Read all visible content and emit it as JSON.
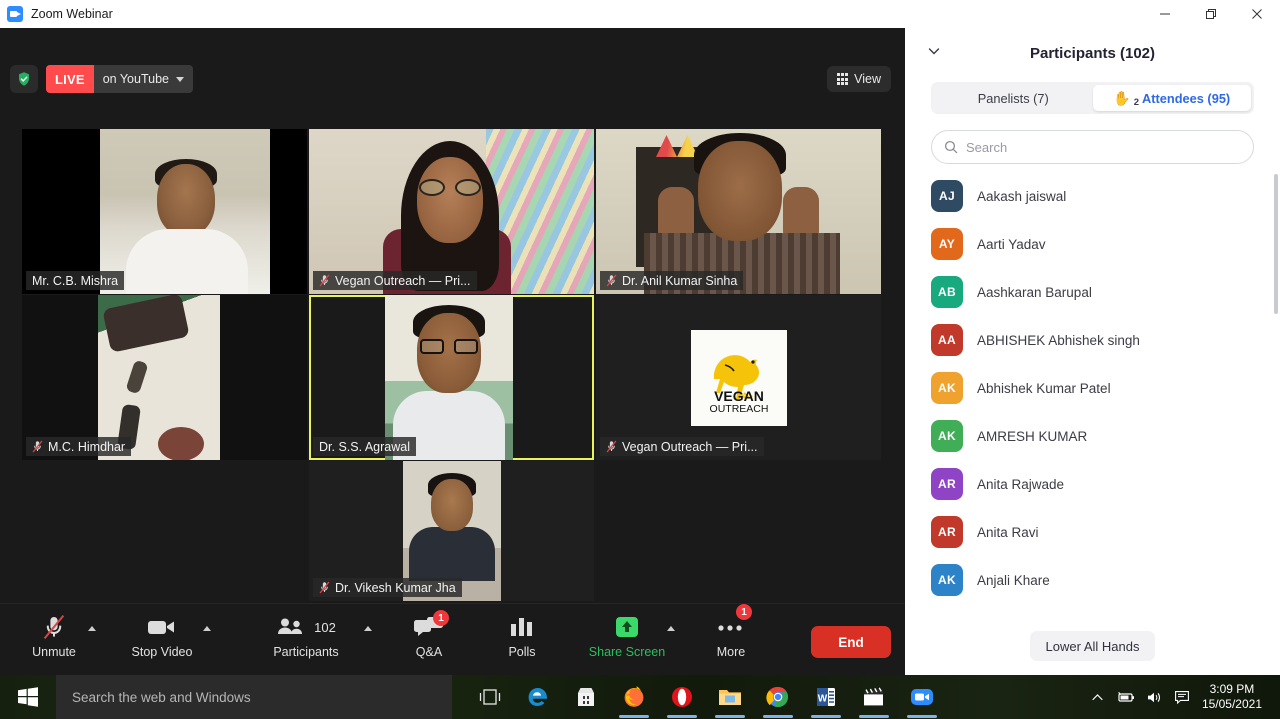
{
  "window": {
    "title": "Zoom Webinar",
    "app_icon": "zoom-video-icon",
    "minimize": "minimize-icon",
    "maximize": "restore-icon",
    "close": "close-icon"
  },
  "topbar": {
    "encryption_icon": "shield-check-icon",
    "live_badge": "LIVE",
    "live_target": "on YouTube",
    "live_caret": "chevron-down-icon",
    "view_label": "View",
    "view_icon": "grid-icon"
  },
  "tiles": [
    {
      "name": "Mr. C.B. Mishra",
      "muted": false,
      "active": false,
      "style": "vid-a"
    },
    {
      "name": "Vegan Outreach — Pri...",
      "muted": true,
      "active": false,
      "style": "vid-b"
    },
    {
      "name": "Dr. Anil Kumar Sinha",
      "muted": true,
      "active": false,
      "style": "vid-c"
    },
    {
      "name": "M.C. Himdhar",
      "muted": true,
      "active": false,
      "style": "vid-d"
    },
    {
      "name": "Dr. S.S. Agrawal",
      "muted": false,
      "active": true,
      "style": "vid-e"
    },
    {
      "name": "Vegan Outreach — Pri...",
      "muted": true,
      "active": false,
      "style": "vid-f",
      "logo_text_1": "VEGAN",
      "logo_text_2": "OUTREACH"
    },
    {
      "name": "Dr. Vikesh Kumar Jha",
      "muted": true,
      "active": false,
      "style": "vid-g"
    }
  ],
  "toolbar": {
    "items": [
      {
        "label": "Unmute",
        "icon": "microphone-muted-icon",
        "caret": true,
        "badge": null,
        "count": null,
        "accent": "#e2e2e2"
      },
      {
        "label": "Stop Video",
        "icon": "video-camera-icon",
        "caret": true,
        "badge": null,
        "count": null,
        "accent": "#e2e2e2"
      },
      {
        "label": "Participants",
        "icon": "participants-icon",
        "caret": true,
        "badge": null,
        "count": "102",
        "accent": "#e2e2e2"
      },
      {
        "label": "Q&A",
        "icon": "qa-chat-icon",
        "caret": false,
        "badge": "1",
        "count": null,
        "accent": "#e2e2e2"
      },
      {
        "label": "Polls",
        "icon": "polls-bar-icon",
        "caret": false,
        "badge": null,
        "count": null,
        "accent": "#e2e2e2"
      },
      {
        "label": "Share Screen",
        "icon": "share-screen-icon",
        "caret": true,
        "badge": null,
        "count": null,
        "accent": "#2DBF5C"
      },
      {
        "label": "More",
        "icon": "more-dots-icon",
        "caret": false,
        "badge": "1",
        "count": null,
        "accent": "#e2e2e2"
      }
    ],
    "end_label": "End",
    "end_color": "#D93025"
  },
  "panel": {
    "collapse_icon": "chevron-down-icon",
    "title": "Participants (102)",
    "tabs": [
      {
        "label": "Panelists (7)",
        "active": false,
        "hand_icon": null,
        "hand_count": null
      },
      {
        "label": "Attendees (95)",
        "active": true,
        "hand_icon": "raised-hand-icon",
        "hand_count": "2"
      }
    ],
    "search": {
      "icon": "search-icon",
      "placeholder": "Search",
      "value": ""
    },
    "participants": [
      {
        "initials": "AJ",
        "name": "Aakash jaiswal",
        "color": "#2F4B63"
      },
      {
        "initials": "AY",
        "name": "Aarti Yadav",
        "color": "#E2691C"
      },
      {
        "initials": "AB",
        "name": "Aashkaran Barupal",
        "color": "#18A97E"
      },
      {
        "initials": "AA",
        "name": "ABHISHEK Abhishek singh",
        "color": "#C0392B"
      },
      {
        "initials": "AK",
        "name": "Abhishek Kumar Patel",
        "color": "#F0A22E"
      },
      {
        "initials": "AK",
        "name": "AMRESH KUMAR",
        "color": "#3FAE57"
      },
      {
        "initials": "AR",
        "name": "Anita Rajwade",
        "color": "#8E44C4"
      },
      {
        "initials": "AR",
        "name": "Anita Ravi",
        "color": "#C0392B"
      },
      {
        "initials": "AK",
        "name": "Anjali Khare",
        "color": "#2D83C8"
      }
    ],
    "lower_all_hands": "Lower All Hands"
  },
  "taskbar": {
    "start_icon": "windows-start-icon",
    "search_placeholder": "Search the web and Windows",
    "task_view_icon": "task-view-icon",
    "apps": [
      {
        "icon": "edge-icon",
        "open": false
      },
      {
        "icon": "microsoft-store-icon",
        "open": false
      },
      {
        "icon": "firefox-icon",
        "open": true
      },
      {
        "icon": "opera-icon",
        "open": true
      },
      {
        "icon": "file-explorer-icon",
        "open": true
      },
      {
        "icon": "chrome-icon",
        "open": true
      },
      {
        "icon": "word-icon",
        "open": true
      },
      {
        "icon": "movies-tv-icon",
        "open": true
      },
      {
        "icon": "zoom-icon",
        "open": true
      }
    ],
    "tray": [
      {
        "icon": "show-hidden-icons-icon"
      },
      {
        "icon": "battery-icon"
      },
      {
        "icon": "volume-icon"
      },
      {
        "icon": "action-center-icon"
      }
    ],
    "time": "3:09 PM",
    "date": "15/05/2021"
  }
}
